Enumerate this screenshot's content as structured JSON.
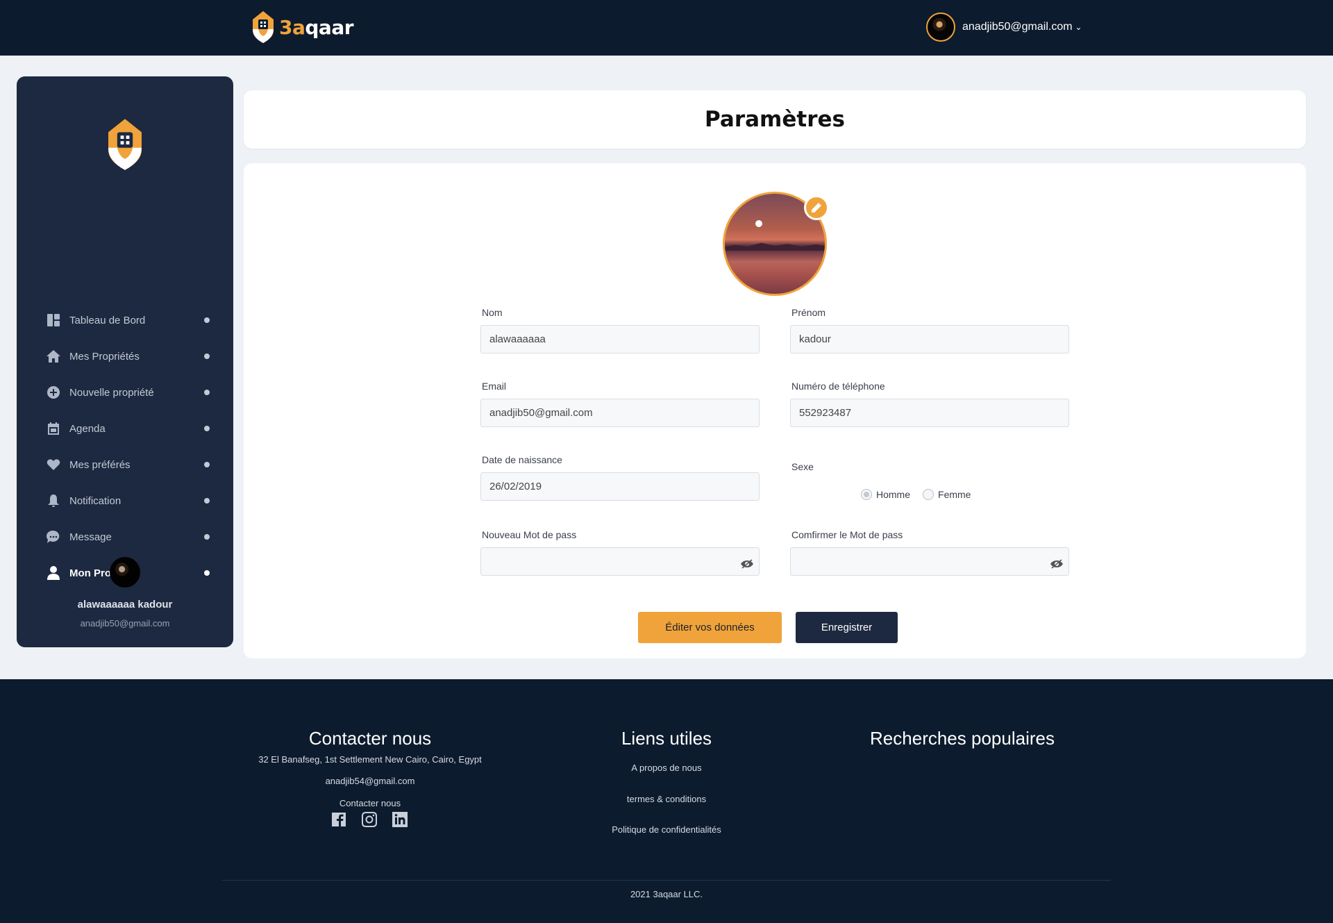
{
  "header": {
    "brand_prefix": "3a",
    "brand_suffix": "qaar",
    "user_email": "anadjib50@gmail.com"
  },
  "sidebar": {
    "items": [
      {
        "label": "Tableau de Bord",
        "icon": "dashboard-icon"
      },
      {
        "label": "Mes Propriétés",
        "icon": "home-icon"
      },
      {
        "label": "Nouvelle propriété",
        "icon": "plus-circle-icon"
      },
      {
        "label": "Agenda",
        "icon": "calendar-icon"
      },
      {
        "label": "Mes préférés",
        "icon": "heart-icon"
      },
      {
        "label": "Notification",
        "icon": "bell-icon"
      },
      {
        "label": "Message",
        "icon": "chat-icon"
      },
      {
        "label": "Mon Profile",
        "icon": "user-icon",
        "active": true
      }
    ],
    "user_name": "alawaaaaaa kadour",
    "user_email": "anadjib50@gmail.com"
  },
  "page": {
    "title": "Paramètres"
  },
  "form": {
    "nom": {
      "label": "Nom",
      "value": "alawaaaaaa"
    },
    "prenom": {
      "label": "Prénom",
      "value": "kadour"
    },
    "email": {
      "label": "Email",
      "value": "anadjib50@gmail.com"
    },
    "telephone": {
      "label": "Numéro de téléphone",
      "value": "552923487"
    },
    "naissance": {
      "label": "Date de naissance",
      "value": "26/02/2019"
    },
    "sexe": {
      "label": "Sexe",
      "options": [
        "Homme",
        "Femme"
      ],
      "selected": "Homme"
    },
    "new_password": {
      "label": "Nouveau Mot de pass",
      "value": ""
    },
    "confirm_password": {
      "label": "Comfirmer le Mot de pass",
      "value": ""
    },
    "edit_button": "Éditer vos données",
    "save_button": "Enregistrer"
  },
  "footer": {
    "contact": {
      "title": "Contacter nous",
      "address": "32 El Banafseg, 1st Settlement New Cairo, Cairo, Egypt",
      "email": "anadjib54@gmail.com",
      "contact_link": "Contacter nous"
    },
    "links": {
      "title": "Liens utiles",
      "items": [
        "A propos de nous",
        "termes & conditions",
        "Politique de confidentialités"
      ]
    },
    "popular": {
      "title": "Recherches populaires"
    },
    "copyright": "2021 3aqaar LLC."
  },
  "colors": {
    "accent": "#f0a33a",
    "navy": "#0d1b2e",
    "sidebar": "#1d2940"
  }
}
